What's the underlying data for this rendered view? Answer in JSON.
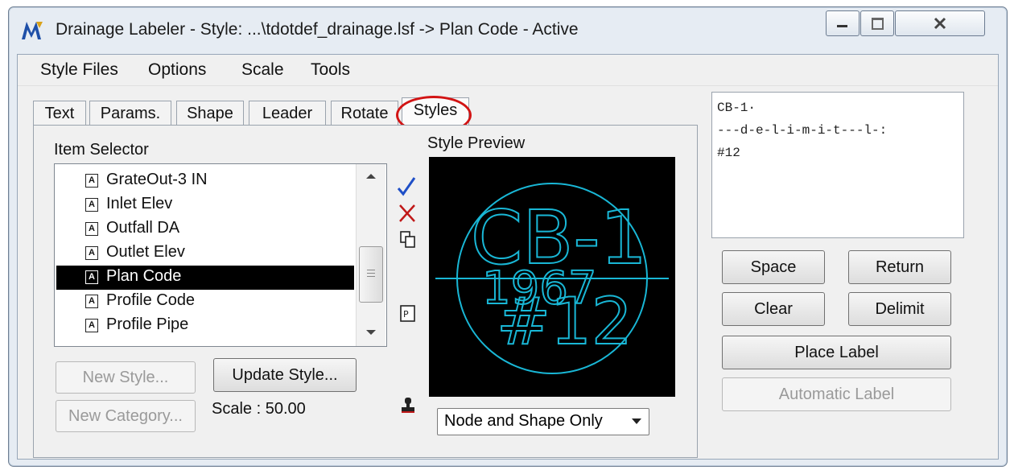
{
  "window": {
    "title": "Drainage Labeler - Style: ...\\tdotdef_drainage.lsf -> Plan Code - Active"
  },
  "menu": [
    "Style Files",
    "Options",
    "Scale",
    "Tools"
  ],
  "tabs": [
    "Text",
    "Params.",
    "Shape",
    "Leader",
    "Rotate",
    "Styles"
  ],
  "item_selector": {
    "label": "Item Selector",
    "items": [
      "GrateOut-3 IN",
      "Inlet Elev",
      "Outfall DA",
      "Outlet Elev",
      "Plan Code",
      "Profile Code",
      "Profile Pipe"
    ],
    "selected": "Plan Code"
  },
  "style_preview": {
    "label": "Style Preview",
    "line1": "CB-1",
    "line2": "1967",
    "line3": "#12",
    "color": "#19b7d6"
  },
  "buttons": {
    "new_style": "New Style...",
    "update_style": "Update Style...",
    "new_category": "New Category...",
    "space": "Space",
    "return": "Return",
    "clear": "Clear",
    "delimit": "Delimit",
    "place_label": "Place Label",
    "automatic_label": "Automatic Label"
  },
  "scale_text": "Scale : 50.00",
  "display_mode": "Node and Shape Only",
  "label_text": {
    "line1": "CB-1·",
    "line2": "---d-e-l-i-m-i-t---l-:",
    "line3": "#12"
  },
  "icons": [
    "check-icon",
    "delete-x-icon",
    "copy-icon",
    "paste-icon",
    "stamp-icon"
  ],
  "colors": {
    "highlight_circle": "#d21414",
    "check": "#1f4fc7",
    "preview_bg": "#000000"
  }
}
